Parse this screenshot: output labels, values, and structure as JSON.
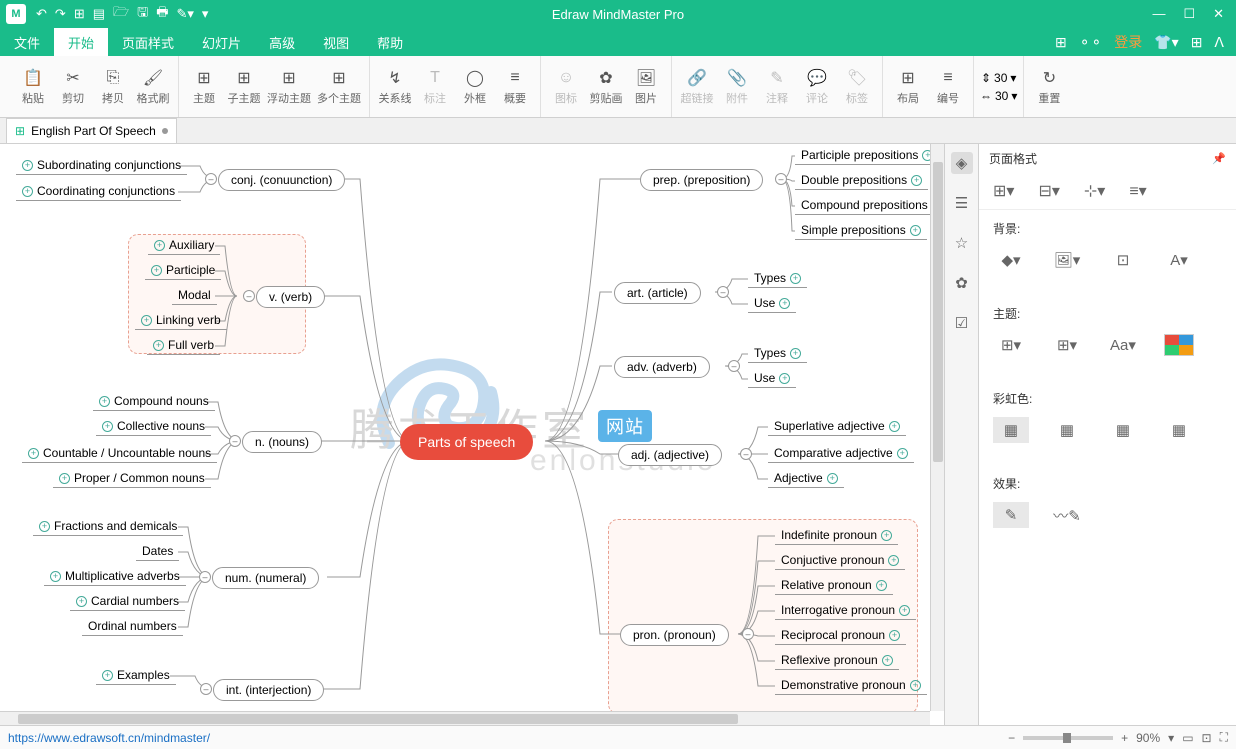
{
  "app": {
    "title": "Edraw MindMaster Pro"
  },
  "qat": [
    "↶",
    "↷",
    "⊞",
    "▤",
    "🗁",
    "🖫",
    "🖶",
    "✎▾",
    "▾"
  ],
  "menu": {
    "items": [
      "文件",
      "开始",
      "页面样式",
      "幻灯片",
      "高级",
      "视图",
      "帮助"
    ],
    "active": 1,
    "login": "登录"
  },
  "ribbon": {
    "g1": [
      {
        "ico": "📋",
        "lbl": "粘贴"
      },
      {
        "ico": "✂",
        "lbl": "剪切"
      },
      {
        "ico": "⎘",
        "lbl": "拷贝"
      },
      {
        "ico": "🖌",
        "lbl": "格式刷"
      }
    ],
    "g2": [
      {
        "ico": "⊞",
        "lbl": "主题"
      },
      {
        "ico": "⊞",
        "lbl": "子主题"
      },
      {
        "ico": "⊞",
        "lbl": "浮动主题"
      },
      {
        "ico": "⊞",
        "lbl": "多个主题"
      }
    ],
    "g3": [
      {
        "ico": "↯",
        "lbl": "关系线"
      },
      {
        "ico": "T",
        "lbl": "标注",
        "dis": true
      },
      {
        "ico": "◯",
        "lbl": "外框"
      },
      {
        "ico": "≡",
        "lbl": "概要"
      }
    ],
    "g4": [
      {
        "ico": "☺",
        "lbl": "图标",
        "dis": true
      },
      {
        "ico": "✿",
        "lbl": "剪贴画"
      },
      {
        "ico": "🖼",
        "lbl": "图片"
      }
    ],
    "g5": [
      {
        "ico": "🔗",
        "lbl": "超链接",
        "dis": true
      },
      {
        "ico": "📎",
        "lbl": "附件",
        "dis": true
      },
      {
        "ico": "✎",
        "lbl": "注释",
        "dis": true
      },
      {
        "ico": "💬",
        "lbl": "评论",
        "dis": true
      },
      {
        "ico": "🏷",
        "lbl": "标签",
        "dis": true
      }
    ],
    "g6": [
      {
        "ico": "⊞",
        "lbl": "布局"
      },
      {
        "ico": "≡",
        "lbl": "编号"
      }
    ],
    "g7": {
      "iconTop": "⇕",
      "iconBot": "⇔",
      "top": "30",
      "bot": "30"
    },
    "g8": [
      {
        "ico": "↻",
        "lbl": "重置"
      }
    ]
  },
  "tab": {
    "name": "English Part Of Speech"
  },
  "mindmap": {
    "center": "Parts of speech",
    "left": {
      "conj": {
        "label": "conj. (conuunction)",
        "leaves": [
          "Subordinating conjunctions",
          "Coordinating conjunctions"
        ]
      },
      "verb": {
        "label": "v. (verb)",
        "leaves": [
          "Auxiliary",
          "Participle",
          "Modal",
          "Linking verb",
          "Full  verb"
        ]
      },
      "noun": {
        "label": "n. (nouns)",
        "leaves": [
          "Compound nouns",
          "Collective nouns",
          "Countable / Uncountable nouns",
          "Proper / Common nouns"
        ]
      },
      "num": {
        "label": "num. (numeral)",
        "leaves": [
          "Fractions and demicals",
          "Dates",
          "Multiplicative adverbs",
          "Cardial numbers",
          "Ordinal numbers"
        ]
      },
      "int": {
        "label": "int. (interjection)",
        "leaves": [
          "Examples"
        ]
      }
    },
    "right": {
      "prep": {
        "label": "prep. (preposition)",
        "leaves": [
          "Participle prepositions",
          "Double prepositions",
          "Compound prepositions",
          "Simple prepositions"
        ]
      },
      "art": {
        "label": "art. (article)",
        "leaves": [
          "Types",
          "Use"
        ]
      },
      "adv": {
        "label": "adv. (adverb)",
        "leaves": [
          "Types",
          "Use"
        ]
      },
      "adj": {
        "label": "adj. (adjective)",
        "leaves": [
          "Superlative adjective",
          "Comparative adjective",
          "Adjective"
        ]
      },
      "pron": {
        "label": "pron. (pronoun)",
        "leaves": [
          "Indefinite pronoun",
          "Conjuctive pronoun",
          "Relative pronoun",
          "Interrogative pronoun",
          "Reciprocal pronoun",
          "Reflexive pronoun",
          "Demonstrative pronoun"
        ]
      }
    }
  },
  "watermark": {
    "text": "腾龙工作室",
    "sub": "enlonstudio",
    "badge": "网站"
  },
  "panel": {
    "title": "页面格式",
    "sections": {
      "bg": "背景:",
      "theme": "主题:",
      "rainbow": "彩虹色:",
      "effect": "效果:"
    }
  },
  "status": {
    "link": "https://www.edrawsoft.cn/mindmaster/",
    "zoom": "90%"
  }
}
